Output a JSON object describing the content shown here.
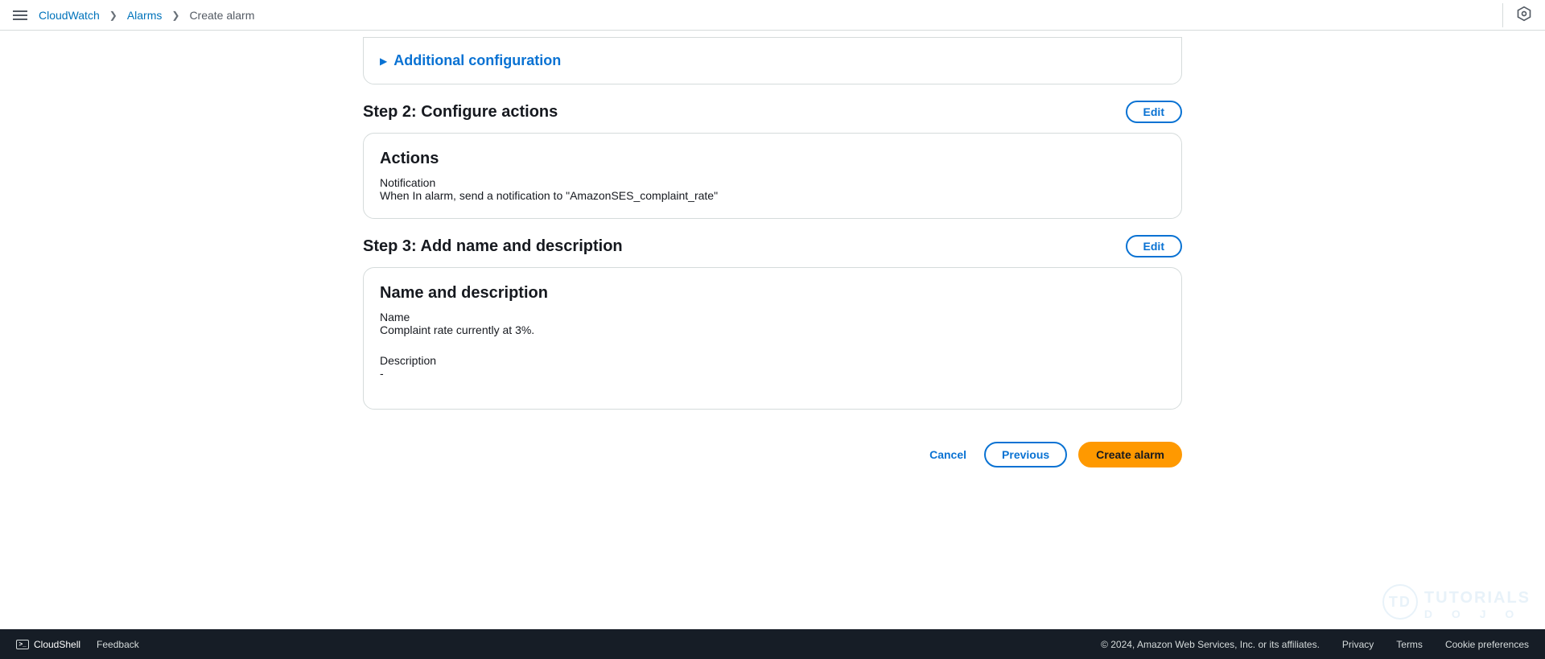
{
  "breadcrumb": {
    "root": "CloudWatch",
    "mid": "Alarms",
    "current": "Create alarm"
  },
  "expandable": {
    "additional_config": "Additional configuration"
  },
  "step2": {
    "title": "Step 2: Configure actions",
    "edit": "Edit",
    "panel_title": "Actions",
    "notification_label": "Notification",
    "notification_text": "When In alarm, send a notification to \"AmazonSES_complaint_rate\""
  },
  "step3": {
    "title": "Step 3: Add name and description",
    "edit": "Edit",
    "panel_title": "Name and description",
    "name_label": "Name",
    "name_value": "Complaint rate currently at 3%.",
    "desc_label": "Description",
    "desc_value": "-"
  },
  "buttons": {
    "cancel": "Cancel",
    "previous": "Previous",
    "create": "Create alarm"
  },
  "footer": {
    "cloudshell": "CloudShell",
    "feedback": "Feedback",
    "copyright": "© 2024, Amazon Web Services, Inc. or its affiliates.",
    "privacy": "Privacy",
    "terms": "Terms",
    "cookies": "Cookie preferences"
  },
  "watermark": {
    "line1": "TUTORIALS",
    "line2": "D O J O",
    "badge": "TD"
  }
}
